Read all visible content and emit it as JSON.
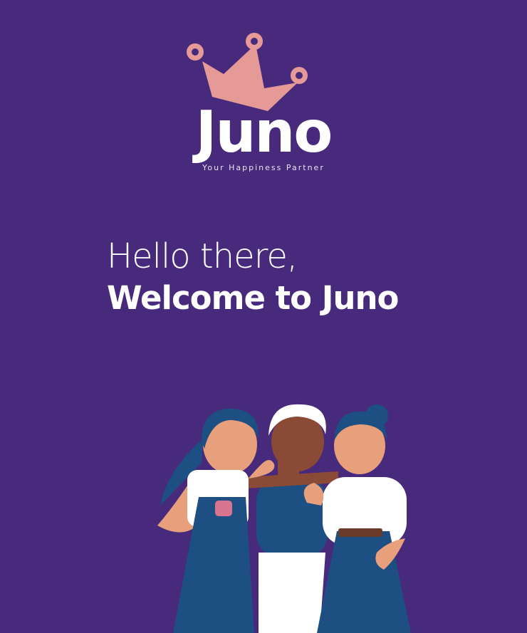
{
  "brand": {
    "name": "Juno",
    "tagline": "Your Happiness Partner",
    "crown_color": "#e59a98"
  },
  "welcome": {
    "greeting": "Hello there,",
    "title": "Welcome to Juno"
  },
  "colors": {
    "background": "#482a7c",
    "text": "#ffffff"
  },
  "illustration": {
    "icon": "three-friends-illustration"
  }
}
